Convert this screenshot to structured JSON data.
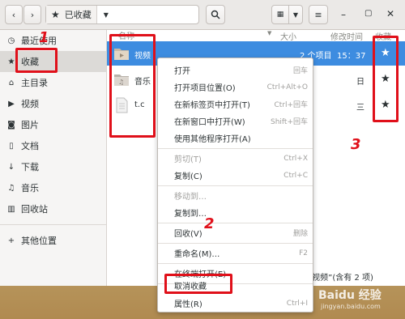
{
  "pathbar": {
    "location": "已收藏"
  },
  "sidebar": {
    "items": [
      {
        "label": "最近使用",
        "icon": "clock-icon",
        "glyph": "◷"
      },
      {
        "label": "收藏",
        "icon": "star-icon",
        "glyph": "★"
      },
      {
        "label": "主目录",
        "icon": "home-icon",
        "glyph": "⌂"
      },
      {
        "label": "视频",
        "icon": "video-icon",
        "glyph": "▶"
      },
      {
        "label": "图片",
        "icon": "camera-icon",
        "glyph": "◙"
      },
      {
        "label": "文档",
        "icon": "document-icon",
        "glyph": "▯"
      },
      {
        "label": "下载",
        "icon": "download-icon",
        "glyph": "↓"
      },
      {
        "label": "音乐",
        "icon": "music-icon",
        "glyph": "♫"
      },
      {
        "label": "回收站",
        "icon": "trash-icon",
        "glyph": "▥"
      },
      {
        "label": "其他位置",
        "icon": "plus-icon",
        "glyph": "+"
      }
    ]
  },
  "columns": {
    "name": "名称",
    "size": "大小",
    "modified": "修改时间",
    "starred": "收藏"
  },
  "files": [
    {
      "name": "视频",
      "size": "2 个项目",
      "modified": "15：37",
      "icon": "folder-video-icon"
    },
    {
      "name": "音乐",
      "size": "",
      "modified": "日",
      "icon": "folder-music-icon"
    },
    {
      "name": "t.c",
      "size": "",
      "modified": "三",
      "icon": "text-file-icon"
    }
  ],
  "context_menu": [
    {
      "label": "打开",
      "shortcut": "回车",
      "disabled": false
    },
    {
      "label": "打开项目位置(O)",
      "shortcut": "Ctrl+Alt+O",
      "disabled": false
    },
    {
      "label": "在新标签页中打开(T)",
      "shortcut": "Ctrl+回车",
      "disabled": false
    },
    {
      "label": "在新窗口中打开(W)",
      "shortcut": "Shift+回车",
      "disabled": false
    },
    {
      "label": "使用其他程序打开(A)",
      "shortcut": "",
      "disabled": false
    },
    {
      "label": "剪切(T)",
      "shortcut": "Ctrl+X",
      "disabled": true
    },
    {
      "label": "复制(C)",
      "shortcut": "Ctrl+C",
      "disabled": false
    },
    {
      "label": "移动到…",
      "shortcut": "",
      "disabled": true
    },
    {
      "label": "复制到…",
      "shortcut": "",
      "disabled": false
    },
    {
      "label": "回收(V)",
      "shortcut": "删除",
      "disabled": false
    },
    {
      "label": "重命名(M)…",
      "shortcut": "F2",
      "disabled": false
    },
    {
      "label": "在终端打开(E)",
      "shortcut": "",
      "disabled": false
    },
    {
      "label": "取消收藏",
      "shortcut": "",
      "disabled": false
    },
    {
      "label": "属性(R)",
      "shortcut": "Ctrl+I",
      "disabled": false
    }
  ],
  "status": "“视频”(含有 2 项)",
  "watermark": {
    "brand": "Baidu 经验",
    "url": "jingyan.baidu.com"
  },
  "annotations": {
    "one": "1",
    "two": "2",
    "three": "3"
  },
  "colors": {
    "selection": "#3d8ce0",
    "annotation": "#e0101a"
  }
}
